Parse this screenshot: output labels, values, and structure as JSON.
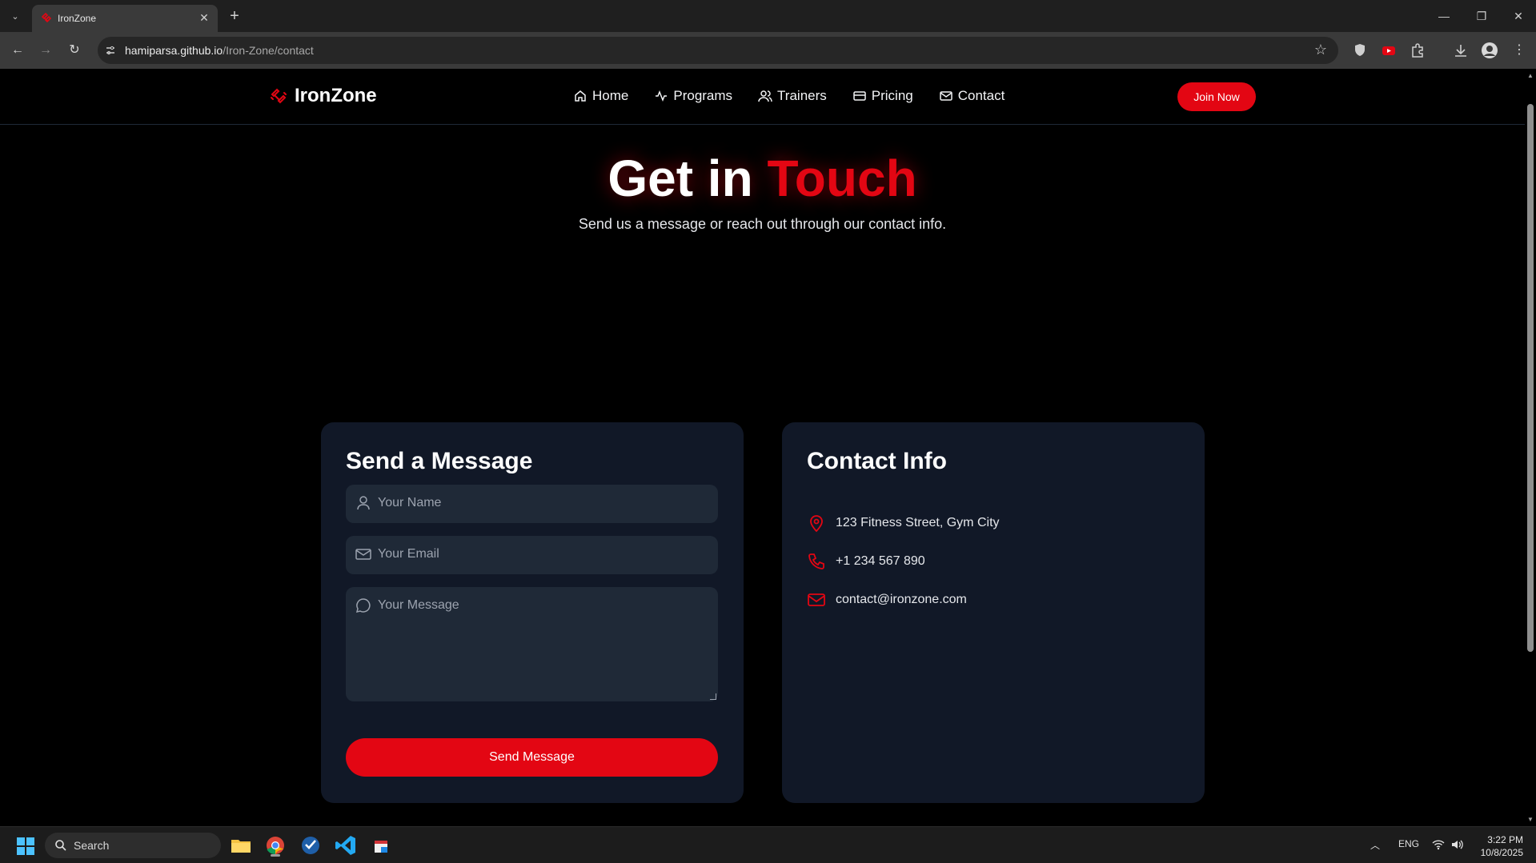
{
  "browser": {
    "tab_title": "IronZone",
    "url_host": "hamiparsa.github.io",
    "url_path": "/Iron-Zone/contact"
  },
  "site": {
    "brand": "IronZone",
    "nav": [
      {
        "label": "Home",
        "icon": "home-icon"
      },
      {
        "label": "Programs",
        "icon": "activity-icon"
      },
      {
        "label": "Trainers",
        "icon": "users-icon"
      },
      {
        "label": "Pricing",
        "icon": "credit-card-icon"
      },
      {
        "label": "Contact",
        "icon": "mail-icon"
      }
    ],
    "join_label": "Join Now",
    "accent_color": "#e30613"
  },
  "hero": {
    "title_part1": "Get in",
    "title_part2": "Touch",
    "subtitle": "Send us a message or reach out through our contact info."
  },
  "form": {
    "title": "Send a Message",
    "name_placeholder": "Your Name",
    "email_placeholder": "Your Email",
    "message_placeholder": "Your Message",
    "submit_label": "Send Message"
  },
  "contact_info": {
    "title": "Contact Info",
    "address": "123 Fitness Street, Gym City",
    "phone": "+1 234 567 890",
    "email": "contact@ironzone.com"
  },
  "taskbar": {
    "search_label": "Search",
    "language": "ENG",
    "time": "3:22 PM",
    "date": "10/8/2025"
  }
}
